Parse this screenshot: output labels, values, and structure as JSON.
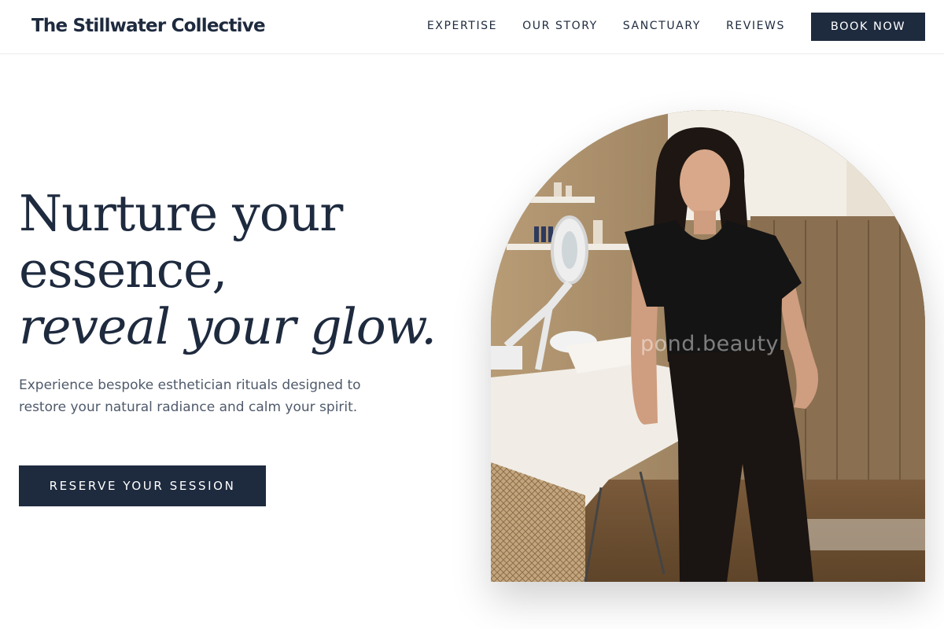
{
  "header": {
    "brand": "The Stillwater Collective",
    "nav": [
      "EXPERTISE",
      "OUR STORY",
      "SANCTUARY",
      "REVIEWS"
    ],
    "book_label": "BOOK NOW"
  },
  "hero": {
    "headline_line1": "Nurture your",
    "headline_line2": "essence,",
    "headline_line3": "reveal your glow.",
    "subtext": "Experience bespoke esthetician rituals designed to restore your natural radiance and calm your spirit.",
    "cta_label": "RESERVE YOUR SESSION"
  },
  "photo": {
    "watermark": "pond.beauty"
  },
  "colors": {
    "primary": "#1e2a3e",
    "body_text": "#4f5a6b",
    "background": "#ffffff"
  }
}
